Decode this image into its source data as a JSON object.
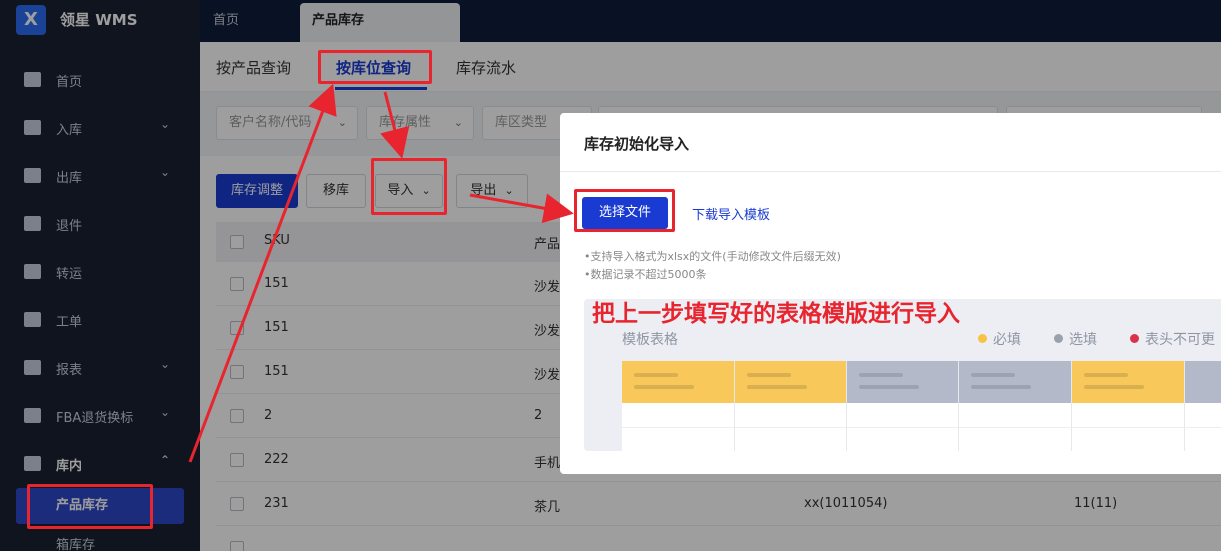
{
  "app": {
    "logo_mark": "X",
    "name": "领星 WMS"
  },
  "top_tabs": {
    "home": "首页",
    "active": "产品库存"
  },
  "sidebar": {
    "items": [
      {
        "label": "首页",
        "icon": "home-icon",
        "chevron": ""
      },
      {
        "label": "入库",
        "icon": "inbound-icon",
        "chevron": "⌄"
      },
      {
        "label": "出库",
        "icon": "outbound-icon",
        "chevron": "⌄"
      },
      {
        "label": "退件",
        "icon": "return-icon",
        "chevron": ""
      },
      {
        "label": "转运",
        "icon": "transfer-icon",
        "chevron": ""
      },
      {
        "label": "工单",
        "icon": "workorder-icon",
        "chevron": ""
      },
      {
        "label": "报表",
        "icon": "report-icon",
        "chevron": "⌄"
      },
      {
        "label": "FBA退货换标",
        "icon": "fba-icon",
        "chevron": "⌄"
      },
      {
        "label": "库内",
        "icon": "warehouse-icon",
        "chevron": "⌃"
      }
    ],
    "sub_active": "产品库存",
    "sub_next": "箱库存"
  },
  "sub_tabs": [
    "按产品查询",
    "按库位查询",
    "库存流水"
  ],
  "filters": [
    {
      "placeholder": "客户名称/代码"
    },
    {
      "placeholder": "库存属性"
    },
    {
      "placeholder": "库区类型"
    }
  ],
  "toolbar": {
    "adjust": "库存调整",
    "move": "移库",
    "import": "导入",
    "export": "导出",
    "caret": "⌄"
  },
  "table": {
    "headers": [
      "SKU",
      "产品"
    ],
    "rows": [
      {
        "sku": "151",
        "product": "沙发",
        "c3": "",
        "c4": ""
      },
      {
        "sku": "151",
        "product": "沙发",
        "c3": "",
        "c4": ""
      },
      {
        "sku": "151",
        "product": "沙发",
        "c3": "",
        "c4": ""
      },
      {
        "sku": "2",
        "product": "2",
        "c3": "",
        "c4": ""
      },
      {
        "sku": "222",
        "product": "手机",
        "c3": "",
        "c4": ""
      },
      {
        "sku": "231",
        "product": "茶几",
        "c3": "xx(1011054)",
        "c4": "11(11)"
      }
    ]
  },
  "modal": {
    "title": "库存初始化导入",
    "select_file": "选择文件",
    "download_template": "下载导入模板",
    "hint1": "•支持导入格式为xlsx的文件(手动修改文件后缀无效)",
    "hint2": "•数据记录不超过5000条",
    "template_title": "模板表格",
    "legend": [
      {
        "label": "必填",
        "color": "#f6c343"
      },
      {
        "label": "选填",
        "color": "#9aa0ad"
      },
      {
        "label": "表头不可更",
        "color": "#d9324a"
      }
    ]
  },
  "annotation": "把上一步填写好的表格模版进行导入",
  "colors": {
    "accent": "#1a3bd1",
    "annotation_red": "#e8252f",
    "sidebar_bg": "#1a2132"
  }
}
